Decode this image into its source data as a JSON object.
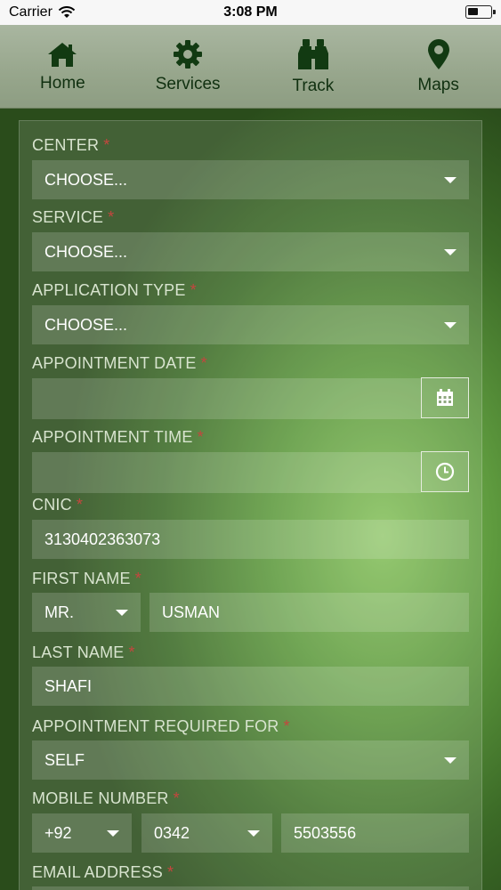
{
  "status_bar": {
    "carrier": "Carrier",
    "time": "3:08 PM",
    "icons": [
      "wifi-icon",
      "battery-icon"
    ]
  },
  "nav": {
    "items": [
      {
        "label": "Home",
        "icon": "home-icon"
      },
      {
        "label": "Services",
        "icon": "gear-icon"
      },
      {
        "label": "Track",
        "icon": "binoculars-icon"
      },
      {
        "label": "Maps",
        "icon": "map-pin-icon"
      }
    ]
  },
  "form": {
    "required_mark": "*",
    "center": {
      "label": "CENTER",
      "value": "CHOOSE..."
    },
    "service": {
      "label": "SERVICE",
      "value": "CHOOSE..."
    },
    "application_type": {
      "label": "APPLICATION TYPE",
      "value": "CHOOSE..."
    },
    "appointment_date": {
      "label": "APPOINTMENT DATE",
      "value": "",
      "icon": "calendar-icon"
    },
    "appointment_time": {
      "label": "APPOINTMENT TIME",
      "value": "",
      "icon": "clock-icon"
    },
    "cnic": {
      "label": "CNIC",
      "value": "3130402363073"
    },
    "first_name": {
      "label": "FIRST NAME",
      "title": "MR.",
      "value": "USMAN"
    },
    "last_name": {
      "label": "LAST NAME",
      "value": "SHAFI"
    },
    "appointment_required_for": {
      "label": "APPOINTMENT REQUIRED FOR",
      "value": "SELF"
    },
    "mobile_number": {
      "label": "MOBILE NUMBER",
      "country_code": "+92",
      "operator_code": "0342",
      "number": "5503556"
    },
    "email_address": {
      "label": "EMAIL ADDRESS"
    }
  },
  "colors": {
    "accent_green": "#87c25d",
    "required_red": "#c4463e",
    "nav_text": "#103010"
  }
}
